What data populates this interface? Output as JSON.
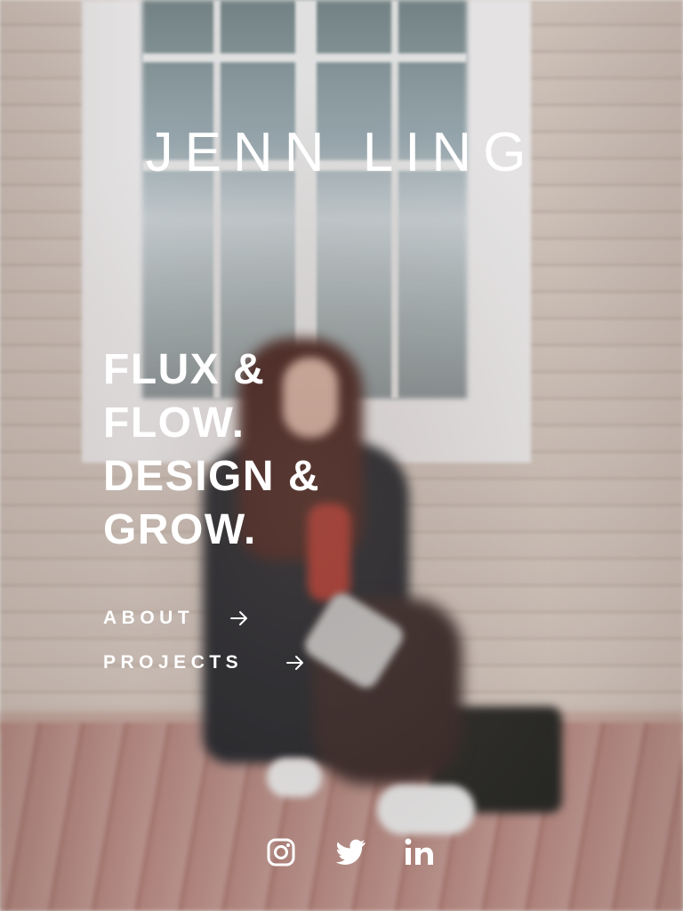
{
  "site": {
    "brand_name": "JENN LING"
  },
  "hero": {
    "tagline_lines": [
      "FLUX &",
      "FLOW.",
      "DESIGN &",
      "GROW."
    ]
  },
  "nav": {
    "items": [
      {
        "label": "ABOUT",
        "icon": "arrow-right-icon"
      },
      {
        "label": "PROJECTS",
        "icon": "arrow-right-icon"
      }
    ]
  },
  "social": {
    "icons": [
      "instagram-icon",
      "twitter-icon",
      "linkedin-icon"
    ]
  },
  "colors": {
    "text": "#ffffff"
  }
}
